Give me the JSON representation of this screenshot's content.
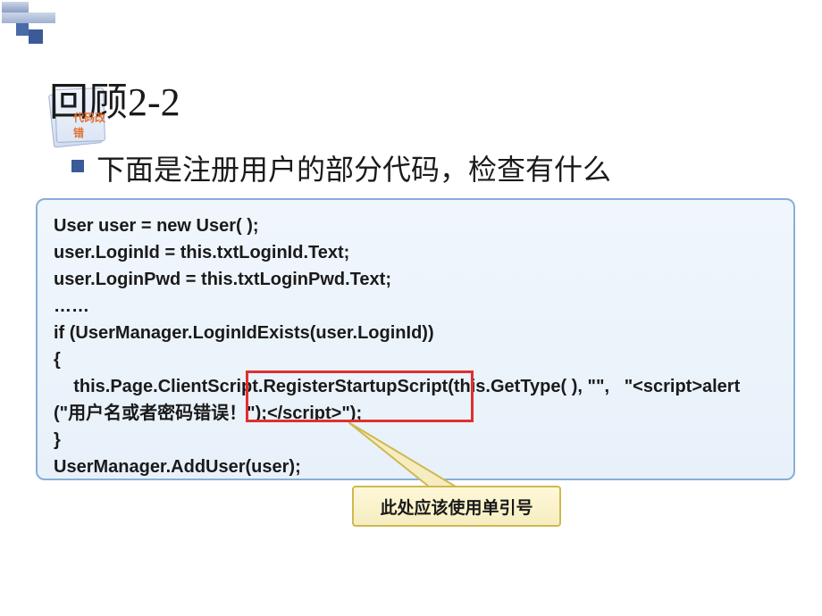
{
  "slide": {
    "title": "回顾2-2",
    "note_label": "代码改错",
    "body_text": "下面是注册用户的部分代码，检查有什么"
  },
  "code": {
    "line1": "User user = new User( );",
    "line2": "user.LoginId = this.txtLoginId.Text;",
    "line3": "user.LoginPwd = this.txtLoginPwd.Text;",
    "line4": "……",
    "line5": "if (UserManager.LoginIdExists(user.LoginId))",
    "line6": "{",
    "line7": "    this.Page.ClientScript.RegisterStartupScript(this.GetType( ), \"\",   \"<script>alert",
    "line8": "(\"用户名或者密码错误！\");</script>\");",
    "line9": "}",
    "line10": "UserManager.AddUser(user);"
  },
  "callout": {
    "text": "此处应该使用单引号"
  }
}
